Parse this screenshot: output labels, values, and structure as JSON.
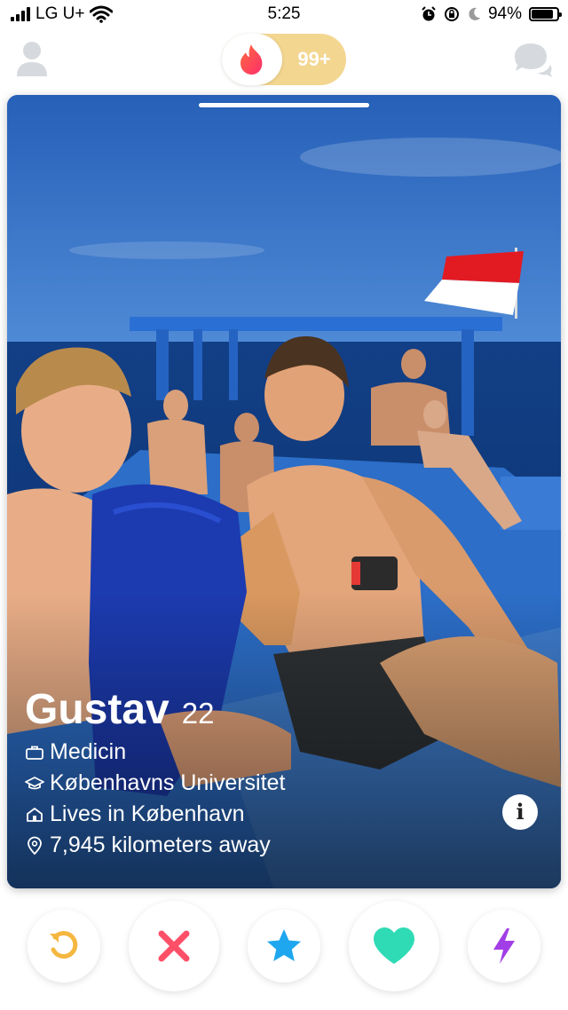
{
  "status_bar": {
    "carrier": "LG U+",
    "time": "5:25",
    "battery": "94%",
    "battery_level": 0.94
  },
  "header": {
    "likes_count": "99+",
    "colors": {
      "accent": "#fd5068",
      "gold": "#f3d690"
    }
  },
  "profile": {
    "name": "Gustav",
    "age": "22",
    "job": "Medicin",
    "school": "Københavns Universitet",
    "city": "Lives in København",
    "distance": "7,945 kilometers away"
  },
  "actions": {
    "rewind_color": "#f5b740",
    "nope_color": "#fd5068",
    "super_like_color": "#1ea7ee",
    "like_color": "#2fdbb5",
    "boost_color": "#a23ee6"
  },
  "icons": [
    "profile-icon",
    "flame-icon",
    "chat-icon",
    "briefcase-icon",
    "graduation-cap-icon",
    "home-icon",
    "location-pin-icon",
    "info-icon",
    "rewind-icon",
    "nope-icon",
    "star-icon",
    "heart-icon",
    "lightning-icon"
  ]
}
